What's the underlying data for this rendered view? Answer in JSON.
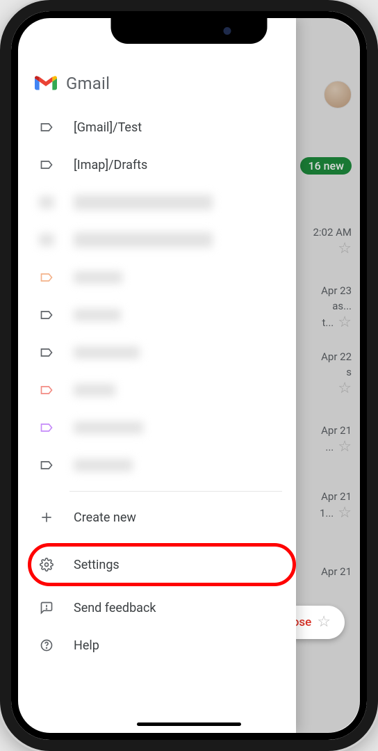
{
  "app": {
    "title": "Gmail"
  },
  "drawer": {
    "labels": [
      {
        "name": "[Gmail]/Test",
        "color": "#5f6368"
      },
      {
        "name": "[Imap]/Drafts",
        "color": "#5f6368"
      },
      {
        "name": "██████",
        "color": "#5f6368",
        "blurred": true
      },
      {
        "name": "██████",
        "color": "#5f6368",
        "blurred": true
      },
      {
        "name": "███",
        "color": "#f4b28a",
        "blurred": true
      },
      {
        "name": "███",
        "color": "#5f6368",
        "blurred": true
      },
      {
        "name": "████",
        "color": "#5f6368",
        "blurred": true
      },
      {
        "name": "███",
        "color": "#f28b82",
        "blurred": true
      },
      {
        "name": "████",
        "color": "#c58af9",
        "blurred": true
      },
      {
        "name": "████",
        "color": "#5f6368",
        "blurred": true
      }
    ],
    "create_new": "Create new",
    "settings": "Settings",
    "send_feedback": "Send feedback",
    "help": "Help"
  },
  "background": {
    "badge": "16 new",
    "items": [
      {
        "time": "2:02 AM",
        "snip": "",
        "star": true
      },
      {
        "time": "Apr 23",
        "snip": "as...",
        "snip2": "t...",
        "star": true
      },
      {
        "time": "Apr 22",
        "snip": "s",
        "star": true
      },
      {
        "time": "Apr 21",
        "snip": "",
        "snip2": "...",
        "star": true
      },
      {
        "time": "Apr 21",
        "snip": "1...",
        "star": true
      },
      {
        "time": "Apr 21",
        "snip": "",
        "star": true
      }
    ],
    "compose": "ose"
  }
}
